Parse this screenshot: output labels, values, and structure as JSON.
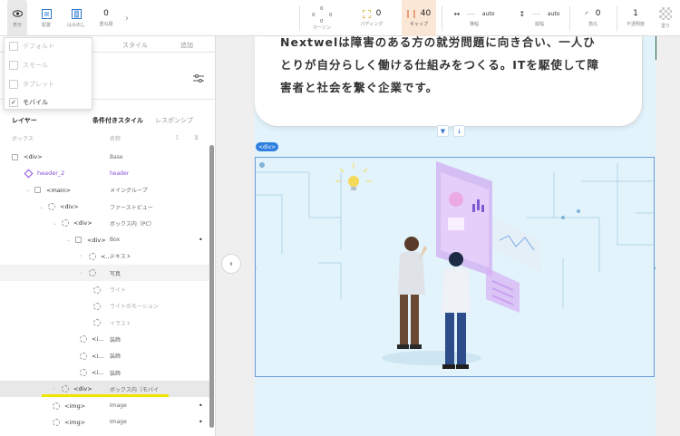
{
  "toolbar": {
    "items": [
      {
        "key": "display",
        "label": "表示",
        "icon": "eye-icon"
      },
      {
        "key": "layout",
        "label": "配置",
        "icon": "layout-icon"
      },
      {
        "key": "overflow",
        "label": "はみ出し",
        "icon": "overflow-icon"
      },
      {
        "key": "zorder",
        "label": "重ね順",
        "value": "0"
      }
    ],
    "margin": {
      "label": "マージン",
      "top": "0",
      "left": "0",
      "right": "0",
      "bottom": "0"
    },
    "padding": {
      "label": "パディング",
      "value": "0"
    },
    "gap": {
      "label": "ギャップ",
      "value": "40"
    },
    "width": {
      "label": "横幅",
      "value": "----",
      "unit": "auto"
    },
    "height": {
      "label": "縦幅",
      "value": "----",
      "unit": "auto"
    },
    "radius": {
      "label": "角丸",
      "value": "0"
    },
    "opacity": {
      "label": "不透明度",
      "value": "1"
    },
    "fill": {
      "label": "塗り"
    }
  },
  "panel": {
    "tabs": [
      "スタイル",
      "追加"
    ],
    "layers_title": "レイヤー",
    "layer_tabs": [
      "条件付きスタイル",
      "レスポンシブ"
    ],
    "col_box": "ボックス",
    "col_name": "名称",
    "dropdown": [
      {
        "label": "デフォルト",
        "checked": false
      },
      {
        "label": "スモール",
        "checked": false
      },
      {
        "label": "タブレット",
        "checked": false
      },
      {
        "label": "モバイル",
        "checked": true
      }
    ],
    "rows": [
      {
        "tag": "<div>",
        "name": "Base",
        "indent": 0,
        "caret": "",
        "icon": "chk",
        "dot": false
      },
      {
        "tag": "header_2",
        "name": "header",
        "indent": 1,
        "caret": "",
        "icon": "component",
        "dot": false,
        "purple": true
      },
      {
        "tag": "<main>",
        "name": "メイングループ",
        "indent": 1,
        "caret": "⌄",
        "icon": "chk",
        "dot": false
      },
      {
        "tag": "<div>",
        "name": "ファーストビュー",
        "indent": 2,
        "caret": "⌄",
        "icon": "dashed",
        "dot": false
      },
      {
        "tag": "<div>",
        "name": "ボックス内（PC）",
        "indent": 3,
        "caret": "⌄",
        "icon": "dashed",
        "dot": false
      },
      {
        "tag": "<div>",
        "name": "Box",
        "indent": 4,
        "caret": "⌄",
        "icon": "chk",
        "dot": true
      },
      {
        "tag": "<...",
        "name": "テキスト",
        "indent": 5,
        "caret": "›",
        "icon": "dashed",
        "dot": false
      },
      {
        "tag": "",
        "name": "写真",
        "indent": 5,
        "caret": "›",
        "icon": "dashed",
        "dot": false,
        "dim": true
      },
      {
        "tag": "",
        "name": "ライト",
        "indent": 6,
        "caret": "",
        "icon": "dashed",
        "dot": false,
        "faded": true
      },
      {
        "tag": "",
        "name": "ライトのモーション",
        "indent": 6,
        "caret": "",
        "icon": "dashed",
        "dot": false,
        "faded": true
      },
      {
        "tag": "",
        "name": "イラスト",
        "indent": 6,
        "caret": "",
        "icon": "dashed",
        "dot": false,
        "faded": true
      },
      {
        "tag": "<i...",
        "name": "装飾",
        "indent": 5,
        "caret": "",
        "icon": "dashed",
        "dot": false
      },
      {
        "tag": "<i...",
        "name": "装飾",
        "indent": 5,
        "caret": "",
        "icon": "dashed",
        "dot": false
      },
      {
        "tag": "<i...",
        "name": "装飾",
        "indent": 5,
        "caret": "",
        "icon": "dashed",
        "dot": false
      },
      {
        "tag": "<div>",
        "name": "ボックス内（モバイ",
        "indent": 3,
        "caret": "›",
        "icon": "dashed",
        "dot": false,
        "selected": true
      },
      {
        "tag": "<img>",
        "name": "Image",
        "indent": 3,
        "caret": "",
        "icon": "dashed",
        "dot": true
      },
      {
        "tag": "<img>",
        "name": "Image",
        "indent": 3,
        "caret": "",
        "icon": "dashed",
        "dot": true
      }
    ]
  },
  "canvas": {
    "hero_lines": [
      "Nextwelは障害のある方の就労問題に向き合い、一人ひ",
      "とりが自分らしく働ける仕組みをつくる。ITを駆使して障",
      "害者と社会を繋ぐ企業です。"
    ],
    "div_badge": "<div>"
  },
  "colors": {
    "accent": "#2f7fe0",
    "highlight": "#f1e500",
    "page_bg": "#e2f3fb",
    "purple": "#8a4fd8"
  }
}
